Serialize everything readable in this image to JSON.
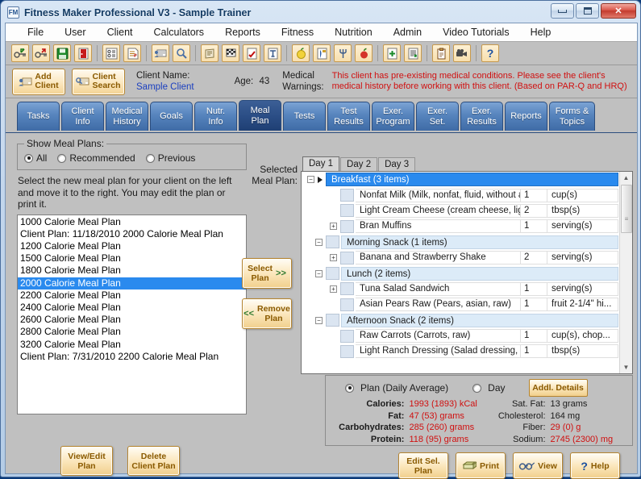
{
  "window": {
    "title": "Fitness Maker Professional V3 - Sample Trainer",
    "app_icon": "FM",
    "minimize": "minimize-icon",
    "maximize": "maximize-icon",
    "close": "✕"
  },
  "menubar": [
    {
      "label": "File",
      "accel": "F"
    },
    {
      "label": "User",
      "accel": "U"
    },
    {
      "label": "Client",
      "accel": "C"
    },
    {
      "label": "Calculators",
      "accel": "a"
    },
    {
      "label": "Reports",
      "accel": "R"
    },
    {
      "label": "Fitness",
      "accel": "F"
    },
    {
      "label": "Nutrition",
      "accel": "N"
    },
    {
      "label": "Admin",
      "accel": "d"
    },
    {
      "label": "Video Tutorials",
      "accel": "V"
    },
    {
      "label": "Help",
      "accel": "H"
    }
  ],
  "toolbar": {
    "buttons": [
      {
        "name": "login-key-icon",
        "glyph": "⚿"
      },
      {
        "name": "logout-key-icon",
        "glyph": "⚿"
      },
      {
        "name": "save-disk-icon",
        "glyph": "Ὃe"
      },
      {
        "name": "exit-door-icon",
        "glyph": "▮"
      },
      {
        "name": "client-list-icon",
        "glyph": "≣"
      },
      {
        "name": "edit-form-icon",
        "glyph": "☑"
      },
      {
        "name": "add-client-icon",
        "glyph": "✐"
      },
      {
        "name": "search-icon",
        "glyph": "⚲"
      },
      {
        "name": "reports-icon",
        "glyph": "☰"
      },
      {
        "name": "goals-flag-icon",
        "glyph": "⚑"
      },
      {
        "name": "tests-check-icon",
        "glyph": "✔"
      },
      {
        "name": "exercise-icon",
        "glyph": "⚒"
      },
      {
        "name": "nutrition-lemon-icon",
        "glyph": "●"
      },
      {
        "name": "meal-plan-icon",
        "glyph": "▤"
      },
      {
        "name": "fork-icon",
        "glyph": "⑂"
      },
      {
        "name": "apple-icon",
        "glyph": "●"
      },
      {
        "name": "new-document-icon",
        "glyph": "+"
      },
      {
        "name": "new-list-icon",
        "glyph": "✱"
      },
      {
        "name": "clipboard-icon",
        "glyph": "▧"
      },
      {
        "name": "video-camera-icon",
        "glyph": "▶"
      },
      {
        "name": "help-icon",
        "glyph": "?"
      }
    ]
  },
  "client_bar": {
    "add_client_label": "Add\nClient",
    "add_client_line1": "Add",
    "add_client_line2": "Client",
    "client_search_line1": "Client",
    "client_search_line2": "Search",
    "client_name_label": "Client Name:",
    "client_name_value": "Sample Client",
    "age_label": "Age:",
    "age_value": "43",
    "medical_warnings_line1": "Medical",
    "medical_warnings_line2": "Warnings:",
    "medical_warning_text": "This client has pre-existing medical conditions. Please see the client's medical history before working with this client.  (Based on PAR-Q and HRQ)"
  },
  "tabs": [
    {
      "label": "Tasks",
      "active": false
    },
    {
      "label": "Client\nInfo",
      "active": false
    },
    {
      "label": "Medical\nHistory",
      "active": false
    },
    {
      "label": "Goals",
      "active": false
    },
    {
      "label": "Nutr.\nInfo",
      "active": false
    },
    {
      "label": "Meal\nPlan",
      "active": true
    },
    {
      "label": "Tests",
      "active": false
    },
    {
      "label": "Test\nResults",
      "active": false
    },
    {
      "label": "Exer.\nProgram",
      "active": false
    },
    {
      "label": "Exer.\nSet.",
      "active": false
    },
    {
      "label": "Exer.\nResults",
      "active": false
    },
    {
      "label": "Reports",
      "active": false
    },
    {
      "label": "Forms &\nTopics",
      "active": false
    }
  ],
  "left_panel": {
    "group_legend": "Show Meal Plans:",
    "radios": [
      {
        "label": "All",
        "selected": true
      },
      {
        "label": "Recommended",
        "selected": false
      },
      {
        "label": "Previous",
        "selected": false
      }
    ],
    "instructions": "Select the new meal plan for your client on the left and move it to the right.  You may edit the plan or print it.",
    "plan_list": [
      {
        "label": "1000 Calorie Meal Plan",
        "selected": false
      },
      {
        "label": "Client Plan: 11/18/2010 2000 Calorie Meal Plan",
        "selected": false
      },
      {
        "label": "1200 Calorie Meal Plan",
        "selected": false
      },
      {
        "label": "1500 Calorie Meal Plan",
        "selected": false
      },
      {
        "label": "1800 Calorie Meal Plan",
        "selected": false
      },
      {
        "label": "2000 Calorie Meal Plan",
        "selected": true
      },
      {
        "label": "2200 Calorie Meal Plan",
        "selected": false
      },
      {
        "label": "2400 Calorie Meal Plan",
        "selected": false
      },
      {
        "label": "2600 Calorie Meal Plan",
        "selected": false
      },
      {
        "label": "2800 Calorie Meal Plan",
        "selected": false
      },
      {
        "label": "3200 Calorie Meal Plan",
        "selected": false
      },
      {
        "label": "Client Plan: 7/31/2010 2200 Calorie Meal Plan",
        "selected": false
      }
    ],
    "view_edit_line1": "View/Edit",
    "view_edit_line2": "Plan",
    "delete_line1": "Delete",
    "delete_line2": "Client Plan"
  },
  "transfer_buttons": {
    "select_line1": "Select",
    "select_line2": "Plan",
    "select_arrows": ">>",
    "remove_line1": "Remove",
    "remove_line2": "Plan",
    "remove_arrows": "<<"
  },
  "selected_plan_label_line1": "Selected",
  "selected_plan_label_line2": "Meal Plan:",
  "day_tabs": [
    {
      "label": "Day 1",
      "active": true
    },
    {
      "label": "Day 2",
      "active": false
    },
    {
      "label": "Day 3",
      "active": false
    }
  ],
  "meal_tree": [
    {
      "type": "group",
      "label": "Breakfast (3 items)",
      "expander": "−",
      "selected": true,
      "cursor": true
    },
    {
      "type": "item",
      "label": "Nonfat Milk (Milk, nonfat, fluid, without adde...",
      "qty": "1",
      "unit": "cup(s)",
      "expander": ""
    },
    {
      "type": "item",
      "label": "Light Cream Cheese (cream cheese, light)",
      "qty": "2",
      "unit": "tbsp(s)",
      "expander": ""
    },
    {
      "type": "item",
      "label": "Bran Muffins",
      "qty": "1",
      "unit": "serving(s)",
      "expander": "+"
    },
    {
      "type": "group",
      "label": "Morning Snack (1 items)",
      "expander": "−",
      "selected": false
    },
    {
      "type": "item",
      "label": "Banana and Strawberry Shake",
      "qty": "2",
      "unit": "serving(s)",
      "expander": "+"
    },
    {
      "type": "group",
      "label": "Lunch (2 items)",
      "expander": "−",
      "selected": false
    },
    {
      "type": "item",
      "label": "Tuna Salad Sandwich",
      "qty": "1",
      "unit": "serving(s)",
      "expander": "+"
    },
    {
      "type": "item",
      "label": "Asian Pears Raw (Pears, asian, raw)",
      "qty": "1",
      "unit": "fruit 2-1/4\" hi...",
      "expander": ""
    },
    {
      "type": "group",
      "label": "Afternoon Snack (2 items)",
      "expander": "−",
      "selected": false
    },
    {
      "type": "item",
      "label": "Raw Carrots (Carrots, raw)",
      "qty": "1",
      "unit": "cup(s), chop...",
      "expander": ""
    },
    {
      "type": "item",
      "label": "Light Ranch Dressing (Salad dressing, KRA...",
      "qty": "1",
      "unit": "tbsp(s)",
      "expander": ""
    }
  ],
  "nutrition": {
    "mode_plan_label": "Plan (Daily Average)",
    "mode_plan_selected": true,
    "mode_day_label": "Day",
    "mode_day_selected": false,
    "addl_details_label": "Addl. Details",
    "left_rows": [
      {
        "label": "Calories:",
        "value": "1993 (1893) kCal",
        "red": true
      },
      {
        "label": "Fat:",
        "value": "47 (53) grams",
        "red": true
      },
      {
        "label": "Carbohydrates:",
        "value": "285 (260) grams",
        "red": true
      },
      {
        "label": "Protein:",
        "value": "118 (95) grams",
        "red": true
      }
    ],
    "right_rows": [
      {
        "label": "Sat. Fat:",
        "value": "13 grams",
        "red": false
      },
      {
        "label": "Cholesterol:",
        "value": "164 mg",
        "red": false
      },
      {
        "label": "Fiber:",
        "value": "29 (0) g",
        "red": true
      },
      {
        "label": "Sodium:",
        "value": "2745 (2300) mg",
        "red": true
      }
    ]
  },
  "bottom_buttons": [
    {
      "name": "edit-sel-plan-button",
      "line1": "Edit Sel.",
      "line2": "Plan",
      "icon": ""
    },
    {
      "name": "print-button",
      "line1": "Print",
      "line2": "",
      "icon": "printer-icon"
    },
    {
      "name": "view-button",
      "line1": "View",
      "line2": "",
      "icon": "glasses-icon"
    },
    {
      "name": "help-button",
      "line1": "Help",
      "line2": "",
      "icon": "question-icon"
    }
  ],
  "colors": {
    "accent_blue": "#2a8aee",
    "tab_active": "#1f3f74",
    "warning_red": "#d01010",
    "gold": "#f1cf8c",
    "link_blue": "#1a3fbf"
  }
}
